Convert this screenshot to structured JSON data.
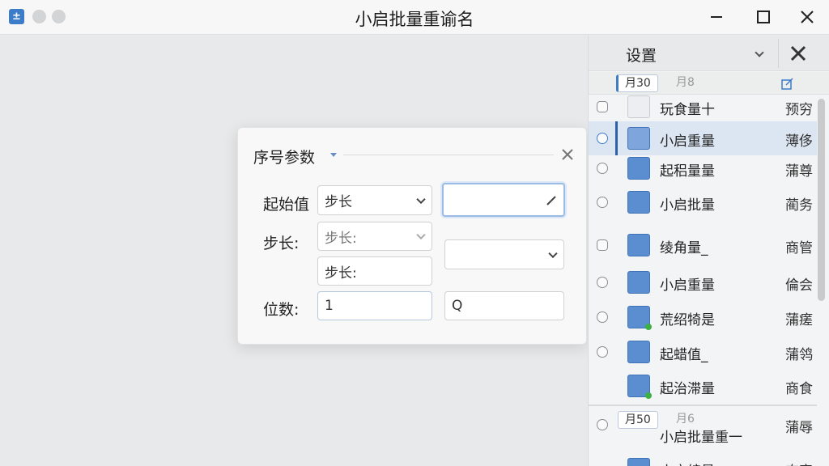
{
  "window": {
    "title": "小启批量重谕名"
  },
  "dialog": {
    "title": "序号参数",
    "start_label": "起始值",
    "start_select": "步长",
    "start_input": "",
    "step_label": "步长:",
    "step_select": "步长:",
    "step_input": "步长:",
    "step_dropdown": "",
    "digits_label": "位数:",
    "digits_value": "1",
    "digits_extra": "Q"
  },
  "panel": {
    "title": "设置",
    "tabs": [
      {
        "label": "月30"
      },
      {
        "label": "月8"
      }
    ],
    "files": [
      {
        "name": "玩食量十",
        "col": "预穷",
        "icon": "doc-icon"
      },
      {
        "name": "小启重量",
        "col": "薄侈",
        "icon": "doc-blue-icon",
        "selected": true
      },
      {
        "name": "起稆量量",
        "col": "蒲尊",
        "icon": "image-icon"
      },
      {
        "name": "小启批量",
        "col": "蔺务",
        "icon": "image-icon"
      },
      {
        "name": "绫角量_",
        "col": "商管",
        "icon": "up-arrow-icon"
      },
      {
        "name": "小启重量",
        "col": "倫会",
        "icon": "up-arrow-icon"
      },
      {
        "name": "荒绍犄是",
        "col": "蒲瘥",
        "icon": "up-arrow-icon"
      },
      {
        "name": "起蜡值_",
        "col": "蒲鸰",
        "icon": "up-arrow-icon"
      },
      {
        "name": "起治滞量",
        "col": "商食",
        "icon": "up-arrow-icon"
      }
    ],
    "footer_tabs": [
      {
        "label": "月50"
      },
      {
        "label": "月6"
      }
    ],
    "footer_files": [
      {
        "name": "小启批量重一",
        "col": "蒲辱",
        "icon": "doc-icon"
      },
      {
        "name": "小启编量",
        "col": "奋旁",
        "icon": "image-icon"
      }
    ]
  },
  "colors": {
    "accent": "#3d7cc9",
    "selection": "#dce6f3",
    "status_green": "#3cb043"
  }
}
